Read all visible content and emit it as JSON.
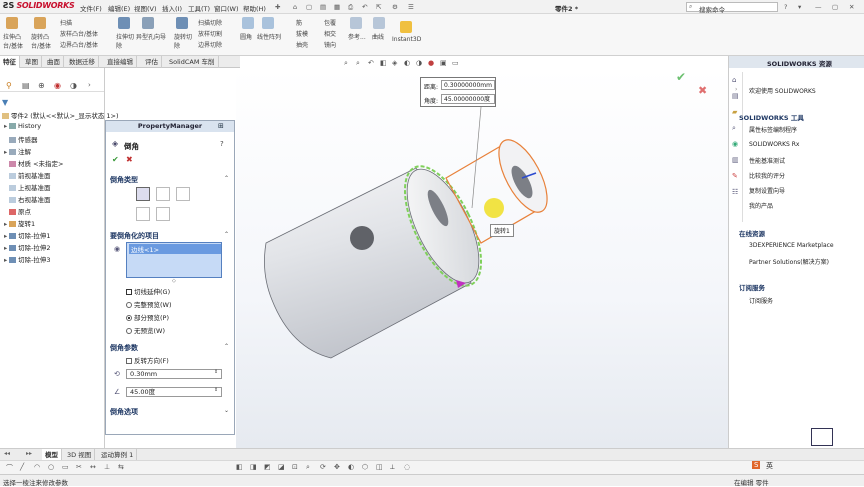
{
  "app": {
    "name": "SOLIDWORKS",
    "doc_title": "零件2 *"
  },
  "menu": [
    "文件(F)",
    "编辑(E)",
    "视图(V)",
    "插入(I)",
    "工具(T)",
    "窗口(W)",
    "帮助(H)"
  ],
  "search": {
    "placeholder": "搜索命令"
  },
  "ribbon": {
    "r1": [
      "拉伸凸",
      "旋转凸",
      "扫描",
      "拉伸切",
      "异型孔向导",
      "旋转切",
      "扫描切除",
      "圆角",
      "线性阵列",
      "筋",
      "包覆",
      "参考...",
      "曲线",
      "Instant3D"
    ],
    "r2": [
      "台/基体",
      "台/基体",
      "放样凸台/基体",
      "除",
      "",
      "除",
      "放样切割",
      "",
      "",
      "拔模",
      "相交",
      "",
      "",
      ""
    ],
    "r3": [
      "",
      "",
      "边界凸台/基体",
      "",
      "",
      "",
      "边界切除",
      "",
      "",
      "抽壳",
      "镜向",
      "",
      "",
      ""
    ]
  },
  "feature_tabs": [
    "特征",
    "草图",
    "曲面",
    "数据迁移",
    "直接编辑",
    "评估",
    "SolidCAM 车削"
  ],
  "tree": {
    "root": "零件2 (默认<<默认>_显示状态 1>)",
    "items": [
      "History",
      "传感器",
      "注解",
      "材质 <未指定>",
      "前视基准面",
      "上视基准面",
      "右视基准面",
      "原点",
      "旋转1",
      "切除-拉伸1",
      "切除-拉伸2",
      "切除-拉伸3"
    ]
  },
  "pm": {
    "header": "PropertyManager",
    "title": "倒角",
    "sec_type": "倒角类型",
    "sec_items": "要倒角化的项目",
    "edge_item": "边线<1>",
    "tangent": "切线延伸(G)",
    "full_preview": "完整预览(W)",
    "partial_preview": "部分预览(P)",
    "no_preview": "无预览(W)",
    "sec_params": "倒角参数",
    "flip": "反转方向(F)",
    "distance": "0.30mm",
    "angle": "45.00度",
    "sec_options": "倒角选项"
  },
  "callout": {
    "dist_label": "距离:",
    "dist_value": "0.30000000mm",
    "angle_label": "角度:",
    "angle_value": "45.00000000度",
    "feature_label": "旋转1"
  },
  "right": {
    "header": "SOLIDWORKS 资源",
    "welcome": "欢迎使用 SOLIDWORKS",
    "tools_head": "SOLIDWORKS 工具",
    "tools": [
      "属性标签编制程序",
      "SOLIDWORKS Rx",
      "性能基准测试",
      "比较我的评分",
      "复制设置向导",
      "我的产品"
    ],
    "online_head": "在线资源",
    "online": [
      "3DEXPERIENCE Marketplace",
      "Partner Solutions(解决方案)"
    ],
    "sub_head": "订阅服务",
    "sub": [
      "订阅服务"
    ]
  },
  "bottom_tabs": [
    "模型",
    "3D 视图",
    "运动算例 1"
  ],
  "status": {
    "left": "选择一棱注来修改参数",
    "editing": "在编辑 零件",
    "ime": "英"
  }
}
